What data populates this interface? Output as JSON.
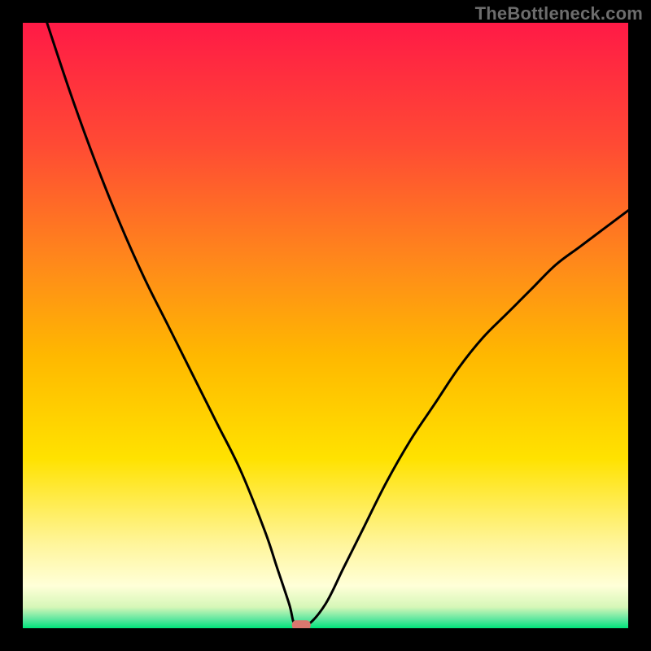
{
  "watermark": "TheBottleneck.com",
  "colors": {
    "black": "#000000",
    "curve": "#000000",
    "marker_fill": "#d9776f",
    "marker_stroke": "#d9776f",
    "gradient_top": "#ff1a46",
    "gradient_mid1": "#ff6a2a",
    "gradient_mid2": "#ffb000",
    "gradient_mid3": "#ffe200",
    "gradient_low1": "#fff59a",
    "gradient_low2": "#ffffcc",
    "gradient_bottom": "#00e47a"
  },
  "chart_data": {
    "type": "line",
    "title": "",
    "xlabel": "",
    "ylabel": "",
    "xlim": [
      0,
      100
    ],
    "ylim": [
      0,
      100
    ],
    "grid": false,
    "legend": false,
    "annotations": [],
    "series": [
      {
        "name": "bottleneck-curve",
        "x": [
          4,
          8,
          12,
          16,
          20,
          24,
          28,
          32,
          36,
          40,
          42,
          44,
          45,
          47,
          50,
          53,
          56,
          60,
          64,
          68,
          72,
          76,
          80,
          84,
          88,
          92,
          96,
          100
        ],
        "values": [
          100,
          88,
          77,
          67,
          58,
          50,
          42,
          34,
          26,
          16,
          10,
          4,
          0.5,
          0.5,
          4,
          10,
          16,
          24,
          31,
          37,
          43,
          48,
          52,
          56,
          60,
          63,
          66,
          69
        ]
      }
    ],
    "marker": {
      "x": 46,
      "y": 0.5
    },
    "background_gradient_stops": [
      {
        "offset": 0.0,
        "color": "#ff1a46"
      },
      {
        "offset": 0.2,
        "color": "#ff4a34"
      },
      {
        "offset": 0.4,
        "color": "#ff8a1a"
      },
      {
        "offset": 0.55,
        "color": "#ffb800"
      },
      {
        "offset": 0.72,
        "color": "#ffe200"
      },
      {
        "offset": 0.86,
        "color": "#fff59a"
      },
      {
        "offset": 0.93,
        "color": "#ffffd8"
      },
      {
        "offset": 0.965,
        "color": "#d6f7b8"
      },
      {
        "offset": 0.985,
        "color": "#5fe7a0"
      },
      {
        "offset": 1.0,
        "color": "#00e47a"
      }
    ]
  }
}
